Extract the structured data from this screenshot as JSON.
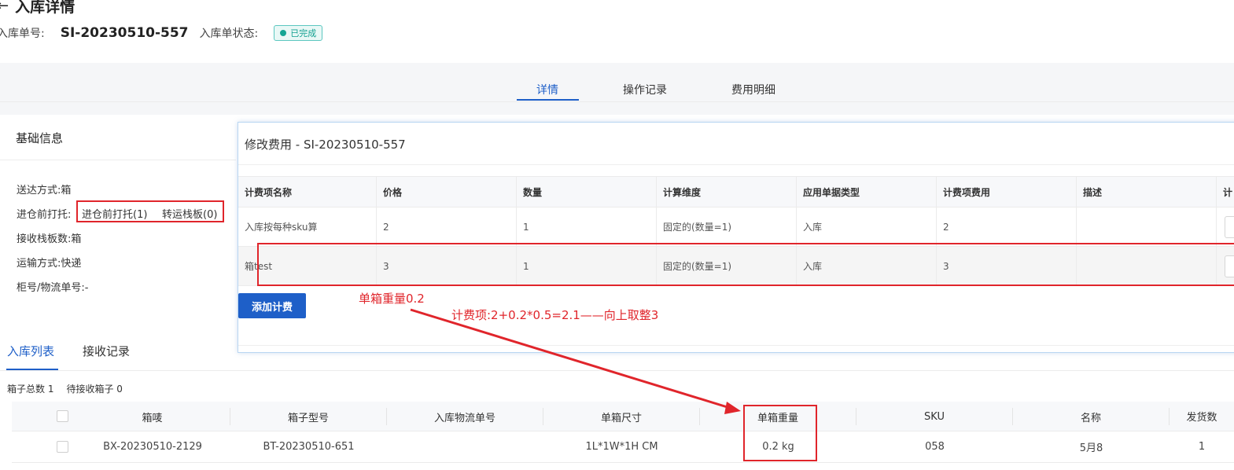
{
  "header": {
    "back_icon": "arrow-left-icon",
    "title": "入库详情",
    "order_no_label": "入库单号:",
    "order_no": "SI-20230510-557",
    "status_label": "入库单状态:",
    "status": "已完成",
    "status_color": "#14a594"
  },
  "tabs": {
    "details": "详情",
    "operation_log": "操作记录",
    "fee_details": "费用明细"
  },
  "basic_info": {
    "title": "基础信息",
    "delivery_method": "送达方式:箱",
    "pallet_label": "进仓前打托:",
    "pallet_before": "进仓前打托(1)",
    "pallet_transfer": "转运栈板(0)",
    "received_pallets": "接收栈板数:箱",
    "transport": "运输方式:快递",
    "container_no": "柜号/物流单号:-"
  },
  "modal": {
    "title": "修改费用 - SI-20230510-557",
    "columns": [
      "计费项名称",
      "价格",
      "数量",
      "计算维度",
      "应用单据类型",
      "计费项费用",
      "描述",
      "计"
    ],
    "rows": [
      [
        "入库按每种sku算",
        "2",
        "1",
        "固定的(数量=1)",
        "入库",
        "2",
        ""
      ],
      [
        "箱test",
        "3",
        "1",
        "固定的(数量=1)",
        "入库",
        "3",
        ""
      ]
    ],
    "add_button": "添加计费"
  },
  "annotations": {
    "box_weight": "单箱重量0.2",
    "fee_formula": "计费项:2+0.2*0.5=2.1——向上取整3",
    "accent_color": "#e0252b"
  },
  "lower": {
    "tab_inbound_list": "入库列表",
    "tab_receive_log": "接收记录",
    "total_boxes": "箱子总数 1",
    "pending_boxes": "待接收箱子 0"
  },
  "box_table": {
    "columns": [
      "箱唛",
      "箱子型号",
      "入库物流单号",
      "单箱尺寸",
      "单箱重量",
      "SKU",
      "名称",
      "发货数"
    ],
    "row": [
      "BX-20230510-2129",
      "BT-20230510-651",
      "",
      "1L*1W*1H CM",
      "0.2 kg",
      "058",
      "5月8",
      "1"
    ]
  }
}
